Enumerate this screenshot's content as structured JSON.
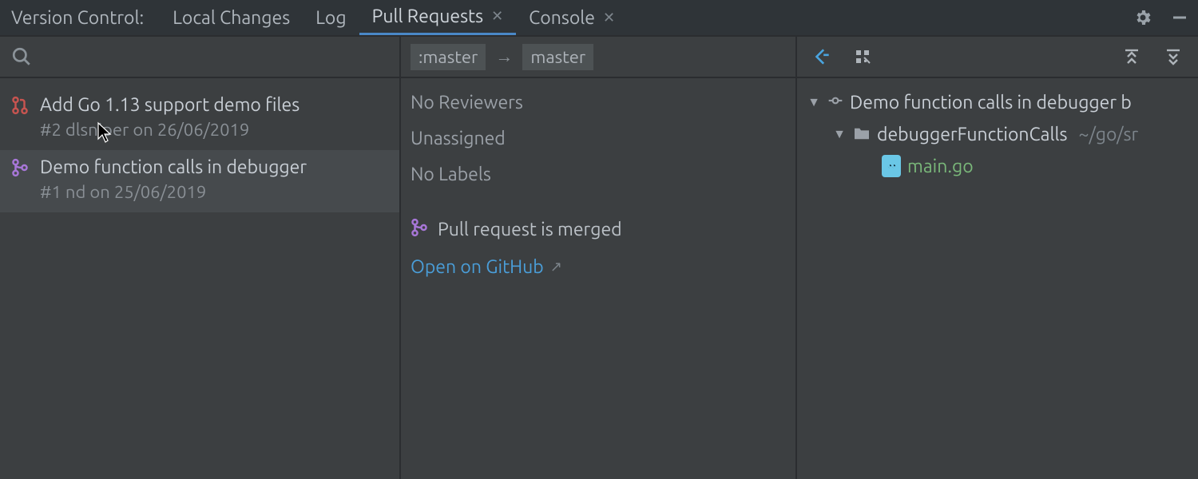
{
  "tabbar": {
    "label": "Version Control:",
    "tabs": [
      {
        "label": "Local Changes",
        "closable": false,
        "active": false
      },
      {
        "label": "Log",
        "closable": false,
        "active": false
      },
      {
        "label": "Pull Requests",
        "closable": true,
        "active": true
      },
      {
        "label": "Console",
        "closable": true,
        "active": false
      }
    ]
  },
  "left": {
    "search_placeholder": "",
    "prs": [
      {
        "title": "Add Go 1.13 support demo files",
        "meta": "#2 dlsniper on 26/06/2019",
        "state": "open",
        "selected": false
      },
      {
        "title": "Demo function calls in debugger",
        "meta": "#1 nd on 25/06/2019",
        "state": "merged",
        "selected": true
      }
    ]
  },
  "mid": {
    "from_branch": ":master",
    "to_branch": "master",
    "reviewers": "No Reviewers",
    "assignees": "Unassigned",
    "labels": "No Labels",
    "status": "Pull request is merged",
    "link_label": "Open on GitHub"
  },
  "right": {
    "root": {
      "label": "Demo function calls in debugger b",
      "children": [
        {
          "label": "debuggerFunctionCalls",
          "path": "~/go/sr",
          "children": [
            {
              "label": "main.go",
              "kind": "go"
            }
          ]
        }
      ]
    }
  },
  "icons": {
    "search": "search-icon",
    "gear": "gear-icon",
    "minimize": "minimize-icon",
    "close": "close-icon",
    "collapse": "collapse-icon",
    "expand": "expand-icon",
    "focus": "focus-icon",
    "group": "group-icon",
    "pr_open": "pr-open-icon",
    "pr_merged": "pr-merged-icon",
    "commit": "commit-icon",
    "folder": "folder-icon",
    "go": "go-file-icon",
    "chevron_down": "chevron-down-icon",
    "arrow": "arrow-right-icon",
    "external": "external-link-icon"
  },
  "colors": {
    "accent": "#4a88c7",
    "link": "#4a9ed9",
    "merged": "#a877d8",
    "open_pr": "#c75450",
    "go_file": "#7ab87a"
  }
}
